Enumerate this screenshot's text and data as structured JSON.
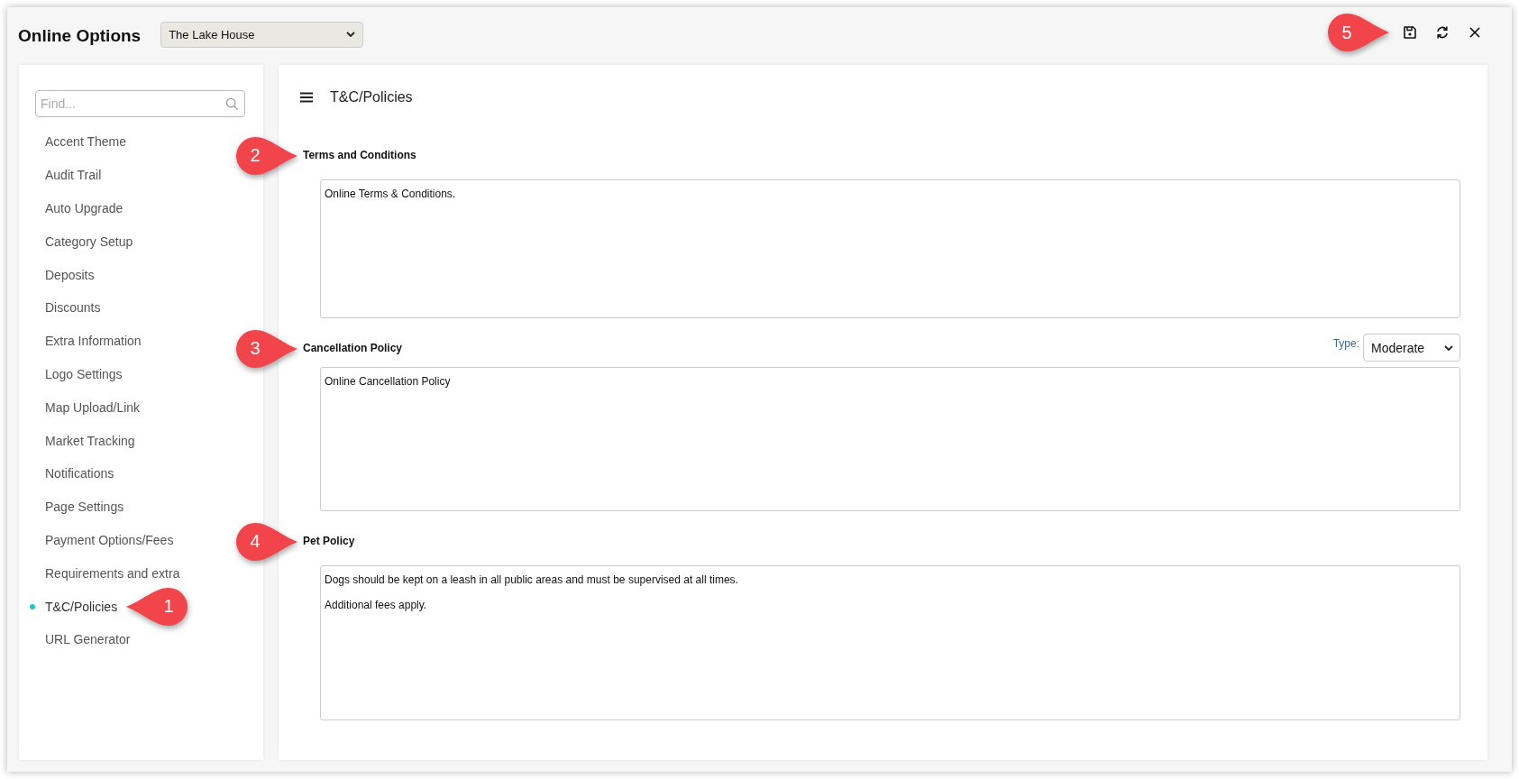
{
  "window": {
    "title": "Online Options",
    "property_select": {
      "value": "The Lake House"
    },
    "toolbar": {
      "callout": "5",
      "buttons": [
        {
          "kind": "save"
        },
        {
          "kind": "refresh"
        },
        {
          "kind": "close"
        }
      ]
    }
  },
  "sidebar": {
    "search": {
      "placeholder": "Find..."
    },
    "items": [
      {
        "label": "Accent Theme",
        "selected": false
      },
      {
        "label": "Audit Trail",
        "selected": false
      },
      {
        "label": "Auto Upgrade",
        "selected": false
      },
      {
        "label": "Category Setup",
        "selected": false
      },
      {
        "label": "Deposits",
        "selected": false
      },
      {
        "label": "Discounts",
        "selected": false
      },
      {
        "label": "Extra Information",
        "selected": false
      },
      {
        "label": "Logo Settings",
        "selected": false
      },
      {
        "label": "Map Upload/Link",
        "selected": false
      },
      {
        "label": "Market Tracking",
        "selected": false
      },
      {
        "label": "Notifications",
        "selected": false
      },
      {
        "label": "Page Settings",
        "selected": false
      },
      {
        "label": "Payment Options/Fees",
        "selected": false
      },
      {
        "label": "Requirements and extra",
        "selected": false
      },
      {
        "label": "T&C/Policies",
        "selected": true,
        "callout": "1"
      },
      {
        "label": "URL Generator",
        "selected": false
      }
    ]
  },
  "main": {
    "title": "T&C/Policies",
    "sections": [
      {
        "heading": "Terms and Conditions",
        "callout": "2",
        "text": "Online Terms & Conditions."
      },
      {
        "heading": "Cancellation Policy",
        "callout": "3",
        "type_label": "Type:",
        "type_value": "Moderate",
        "text": "Online Cancellation Policy"
      },
      {
        "heading": "Pet Policy",
        "callout": "4",
        "text": "Dogs should be kept on a leash in all public areas and must be supervised at all times.\n\nAdditional fees apply."
      }
    ]
  }
}
